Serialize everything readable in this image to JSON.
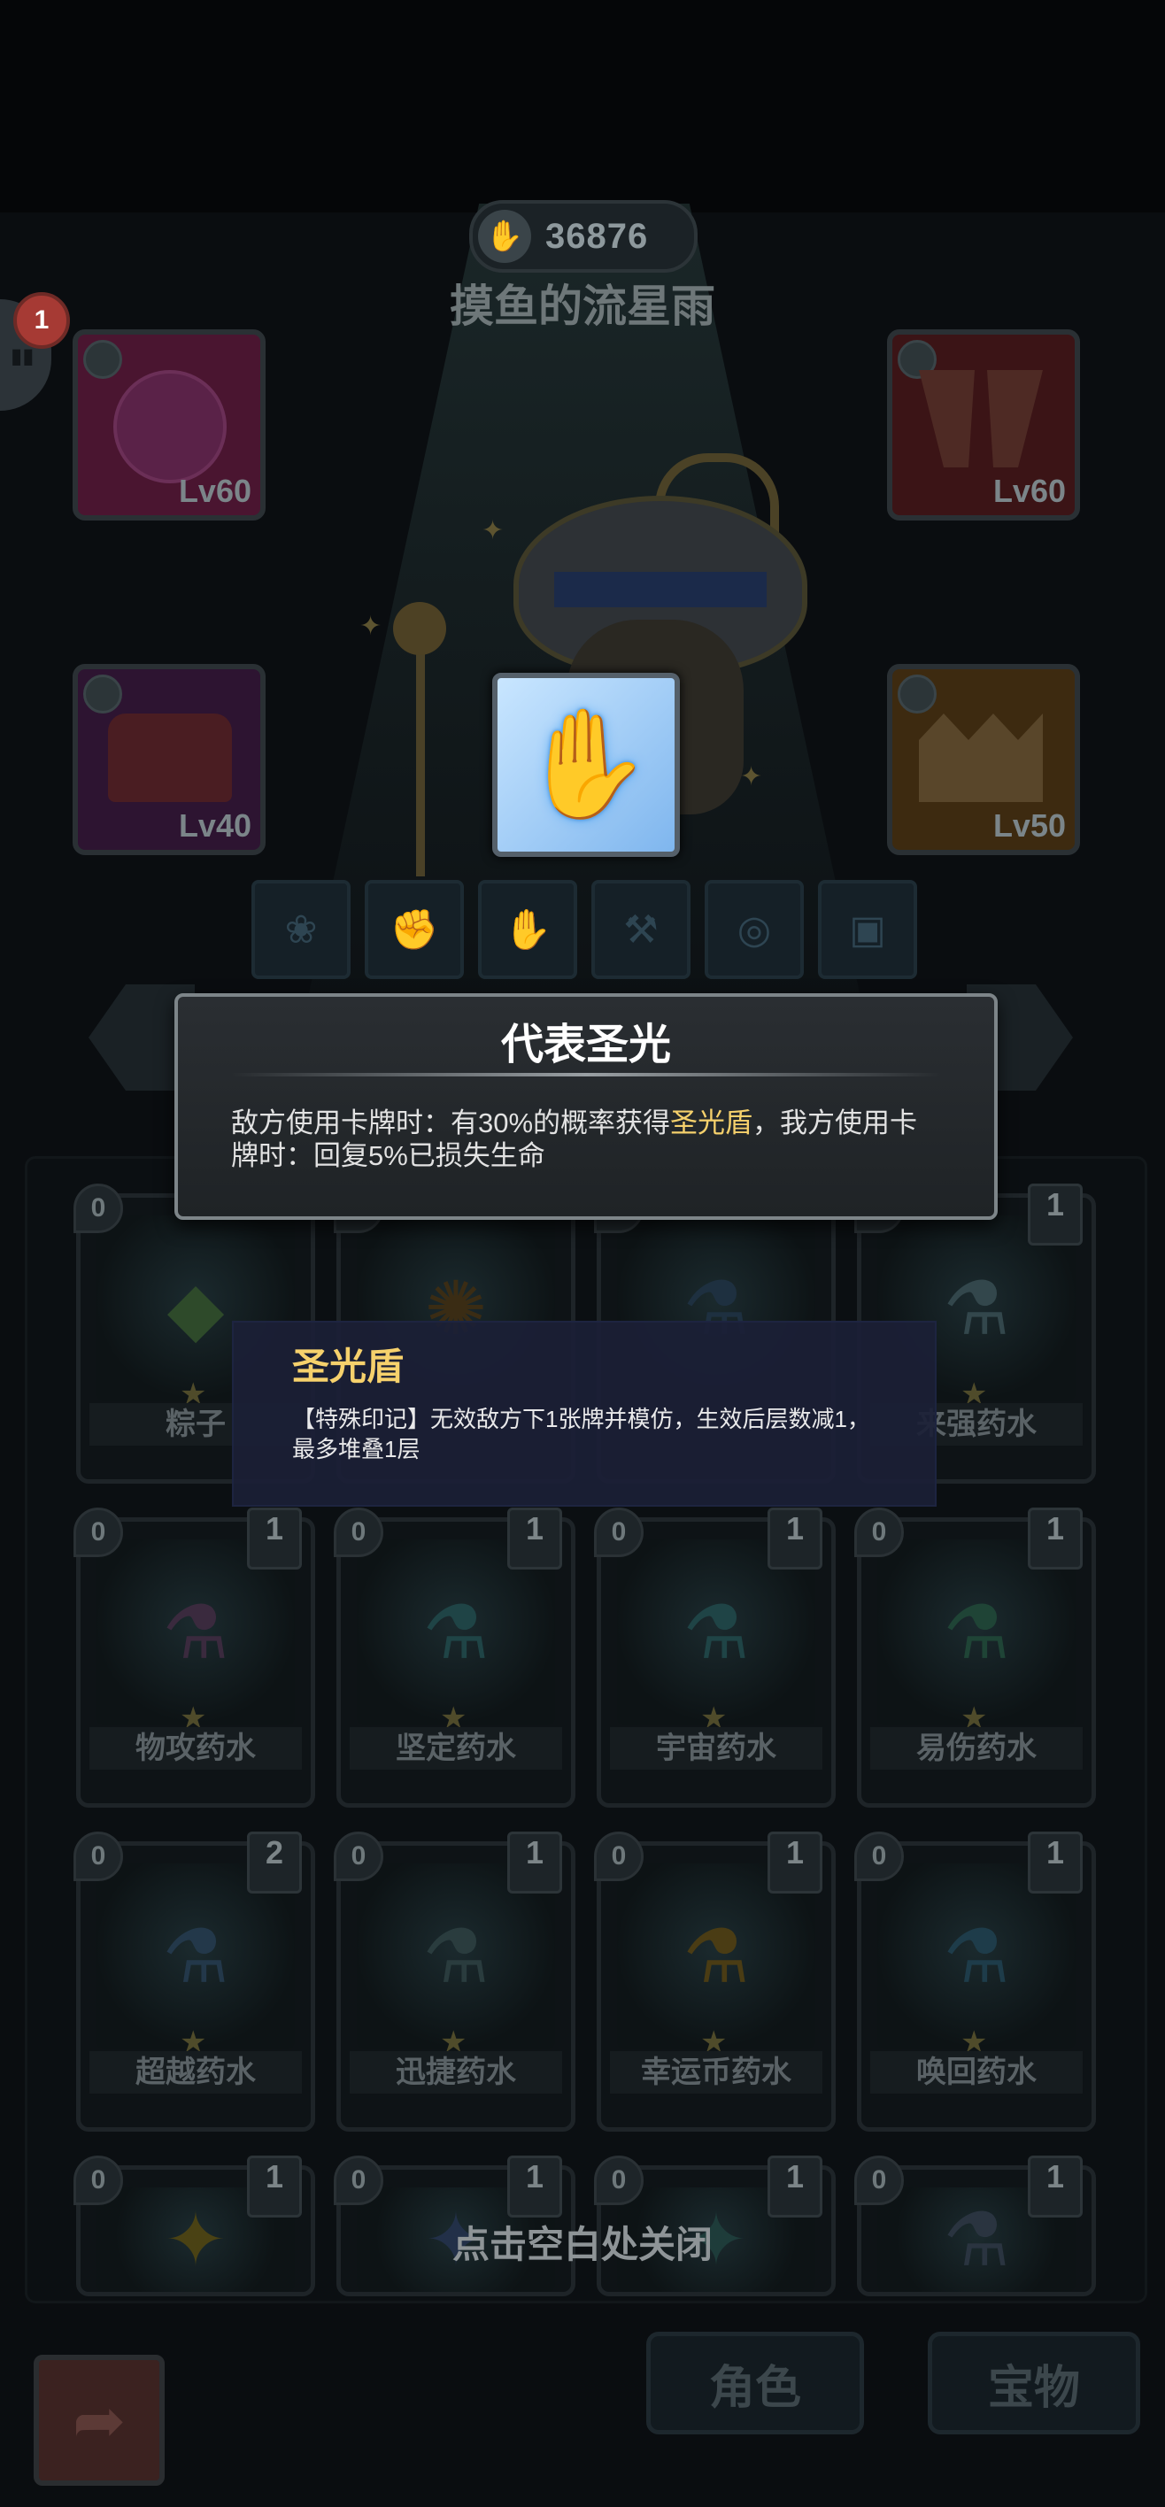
{
  "header": {
    "currency_icon": "coin-icon",
    "currency_value": "36876",
    "player_name": "摸鱼的流星雨"
  },
  "notifications": {
    "badge_count": "1"
  },
  "equipment": [
    {
      "slot": "left-top",
      "level": "Lv60",
      "color": "#4a1530"
    },
    {
      "slot": "right-top",
      "level": "Lv60",
      "color": "#3b1416"
    },
    {
      "slot": "left-bottom",
      "level": "Lv40",
      "color": "#2d1431"
    },
    {
      "slot": "right-bottom",
      "level": "Lv50",
      "color": "#3d2a10"
    }
  ],
  "skill_tooltip": {
    "title": "代表圣光",
    "desc_prefix": "敌方使用卡牌时：有30%的概率获得",
    "desc_highlight": "圣光盾",
    "desc_suffix": "，我方使用卡牌时：回复5%已损失生命"
  },
  "effect_tooltip": {
    "title": "圣光盾",
    "desc": "【特殊印记】无效敌方下1张牌并模仿，生效后层数减1，最多堆叠1层"
  },
  "inventory": {
    "rows": [
      [
        {
          "name": "粽子",
          "count": "",
          "drop": "0"
        },
        {
          "name": "",
          "count": "",
          "drop": "0"
        },
        {
          "name": "",
          "count": "",
          "drop": "0"
        },
        {
          "name": "来强药水",
          "count": "1",
          "drop": "0"
        }
      ],
      [
        {
          "name": "物攻药水",
          "count": "1",
          "drop": "0"
        },
        {
          "name": "坚定药水",
          "count": "1",
          "drop": "0"
        },
        {
          "name": "宇宙药水",
          "count": "1",
          "drop": "0"
        },
        {
          "name": "易伤药水",
          "count": "1",
          "drop": "0"
        }
      ],
      [
        {
          "name": "超越药水",
          "count": "2",
          "drop": "0"
        },
        {
          "name": "迅捷药水",
          "count": "1",
          "drop": "0"
        },
        {
          "name": "幸运币药水",
          "count": "1",
          "drop": "0"
        },
        {
          "name": "唤回药水",
          "count": "1",
          "drop": "0"
        }
      ],
      [
        {
          "name": "",
          "count": "1",
          "drop": "0"
        },
        {
          "name": "",
          "count": "1",
          "drop": "0"
        },
        {
          "name": "",
          "count": "1",
          "drop": "0"
        },
        {
          "name": "",
          "count": "1",
          "drop": "0"
        }
      ]
    ]
  },
  "close_hint": "点击空白处关闭",
  "bottom_bar": {
    "back_icon": "back-arrow-icon",
    "tab_character": "角色",
    "tab_treasure": "宝物"
  },
  "colors": {
    "highlight": "#f6d16c",
    "title": "#ffffff"
  }
}
